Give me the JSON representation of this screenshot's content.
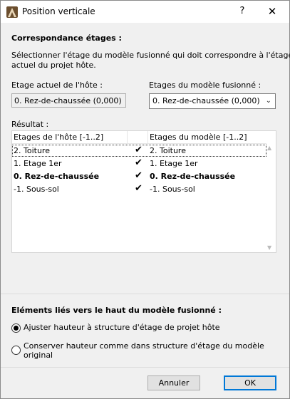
{
  "window": {
    "title": "Position verticale",
    "help": "?",
    "close": "✕"
  },
  "section_correspondance": {
    "heading": "Correspondance étages :",
    "description_line1": "Sélectionner l'étage du modèle fusionné qui doit correspondre à l'étage",
    "description_line2": "actuel du projet hôte."
  },
  "host_story": {
    "label": "Etage actuel de l'hôte :",
    "value": "0. Rez-de-chaussée (0,000)"
  },
  "merged_story": {
    "label": "Etages du modèle fusionné :",
    "selected": "0. Rez-de-chaussée (0,000)"
  },
  "result": {
    "label": "Résultat :",
    "columns": [
      "Etages de l'hôte [-1..2]",
      "Etages du modèle [-1..2]"
    ],
    "rows": [
      {
        "host": "2. Toiture",
        "check": "✔",
        "model": "2. Toiture",
        "bold": false,
        "selected": true
      },
      {
        "host": "1. Etage 1er",
        "check": "✔",
        "model": "1. Etage 1er",
        "bold": false,
        "selected": false
      },
      {
        "host": "0. Rez-de-chaussée",
        "check": "✔",
        "model": "0. Rez-de-chaussée",
        "bold": true,
        "selected": false
      },
      {
        "host": "-1. Sous-sol",
        "check": "✔",
        "model": "-1. Sous-sol",
        "bold": false,
        "selected": false
      }
    ]
  },
  "linked_elements": {
    "heading": "Eléments liés vers le haut du modèle fusionné :",
    "options": [
      {
        "label": "Ajuster hauteur à structure d'étage de projet hôte",
        "checked": true
      },
      {
        "label_line1": "Conserver hauteur comme dans structure d'étage du modèle",
        "label_line2": "original",
        "checked": false
      }
    ]
  },
  "buttons": {
    "cancel": "Annuler",
    "ok": "OK"
  },
  "colors": {
    "dialog_bg": "#f0f0f0",
    "accent": "#0078d7"
  }
}
